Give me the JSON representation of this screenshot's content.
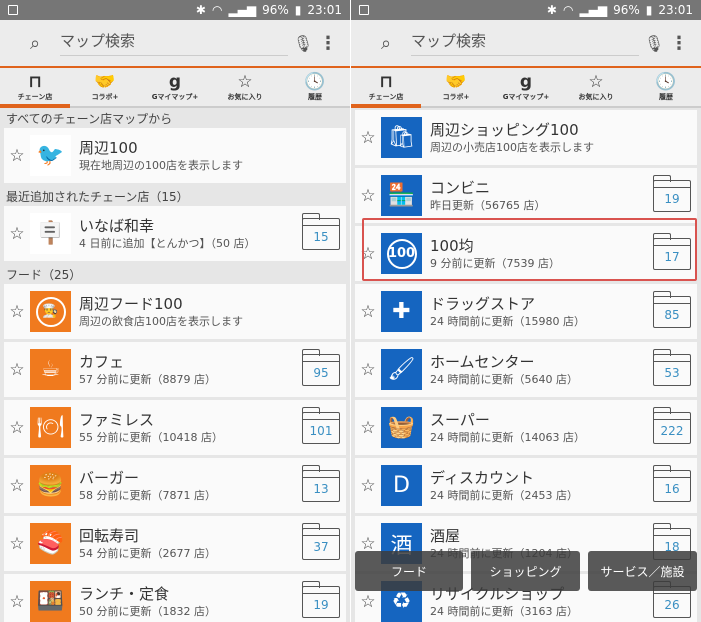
{
  "status": {
    "battery": "96%",
    "time": "23:01"
  },
  "search": {
    "placeholder": "マップ検索"
  },
  "tabs": [
    {
      "label": "チェーン店",
      "icon": "chain-store-icon",
      "glyph": "⊓"
    },
    {
      "label": "コラボ+",
      "icon": "handshake-icon",
      "glyph": "🤝"
    },
    {
      "label": "Gマイマップ+",
      "icon": "g-mymap-icon",
      "glyph": "g"
    },
    {
      "label": "お気に入り",
      "icon": "star-icon",
      "glyph": "☆"
    },
    {
      "label": "履歴",
      "icon": "history-icon",
      "glyph": "🕓"
    }
  ],
  "colors": {
    "accent": "#e0631c",
    "food": "#f07a1e",
    "shopping": "#1565c0",
    "highlight": "#d9534f"
  },
  "left": {
    "sections": [
      {
        "title": "すべてのチェーン店マップから",
        "items": [
          {
            "name": "周辺100",
            "sub": "現在地周辺の100店を表示します",
            "icon": "red-bird-icon",
            "bg": "#fff",
            "glyph": "🐦"
          }
        ]
      },
      {
        "title": "最近追加されたチェーン店（15）",
        "items": [
          {
            "name": "いなば和幸",
            "sub": "4 日前に追加【とんかつ】（50 店）",
            "count": "15",
            "icon": "inaba-sign-icon",
            "bg": "#fff",
            "glyph": "🪧"
          }
        ]
      },
      {
        "title": "フード（25）",
        "items": [
          {
            "name": "周辺フード100",
            "sub": "周辺の飲食店100店を表示します",
            "icon": "chef-icon",
            "bg": "#f07a1e",
            "glyph": "👨‍🍳"
          },
          {
            "name": "カフェ",
            "sub": "57 分前に更新（8879 店）",
            "count": "95",
            "icon": "cup-icon",
            "bg": "#f07a1e",
            "glyph": "☕"
          },
          {
            "name": "ファミレス",
            "sub": "55 分前に更新（10418 店）",
            "count": "101",
            "icon": "dining-icon",
            "bg": "#f07a1e",
            "glyph": "🍽"
          },
          {
            "name": "バーガー",
            "sub": "58 分前に更新（7871 店）",
            "count": "13",
            "icon": "burger-icon",
            "bg": "#f07a1e",
            "glyph": "🍔"
          },
          {
            "name": "回転寿司",
            "sub": "54 分前に更新（2677 店）",
            "count": "37",
            "icon": "sushi-icon",
            "bg": "#f07a1e",
            "glyph": "🍣"
          },
          {
            "name": "ランチ・定食",
            "sub": "50 分前に更新（1832 店）",
            "count": "19",
            "icon": "lunch-icon",
            "bg": "#f07a1e",
            "glyph": "🍱"
          }
        ]
      }
    ]
  },
  "right": {
    "sections": [
      {
        "title": "",
        "items": [
          {
            "name": "周辺ショッピング100",
            "sub": "周辺の小売店100店を表示します",
            "icon": "shopping-bag-icon",
            "bg": "#1565c0",
            "glyph": "🛍"
          },
          {
            "name": "コンビニ",
            "sub": "昨日更新（56765 店）",
            "count": "19",
            "icon": "convenience-store-icon",
            "bg": "#1565c0",
            "glyph": "🏪"
          },
          {
            "name": "100均",
            "sub": "9 分前に更新（7539 店）",
            "count": "17",
            "icon": "100-yen-icon",
            "bg": "#1565c0",
            "glyph": "100"
          },
          {
            "name": "ドラッグストア",
            "sub": "24 時間前に更新（15980 店）",
            "count": "85",
            "icon": "first-aid-icon",
            "bg": "#1565c0",
            "glyph": "✚"
          },
          {
            "name": "ホームセンター",
            "sub": "24 時間前に更新（5640 店）",
            "count": "53",
            "icon": "paint-roller-icon",
            "bg": "#1565c0",
            "glyph": "🖌"
          },
          {
            "name": "スーパー",
            "sub": "24 時間前に更新（14063 店）",
            "count": "222",
            "icon": "basket-icon",
            "bg": "#1565c0",
            "glyph": "🧺"
          },
          {
            "name": "ディスカウント",
            "sub": "24 時間前に更新（2453 店）",
            "count": "16",
            "icon": "discount-d-icon",
            "bg": "#1565c0",
            "glyph": "D"
          },
          {
            "name": "酒屋",
            "sub": "24 時間前に更新（1204 店）",
            "count": "18",
            "icon": "sake-icon",
            "bg": "#1565c0",
            "glyph": "酒"
          },
          {
            "name": "リサイクルショップ",
            "sub": "24 時間前に更新（3163 店）",
            "count": "26",
            "icon": "recycle-icon",
            "bg": "#1565c0",
            "glyph": "♻"
          }
        ]
      }
    ]
  },
  "category_buttons": [
    "フード",
    "ショッピング",
    "サービス／施設"
  ]
}
